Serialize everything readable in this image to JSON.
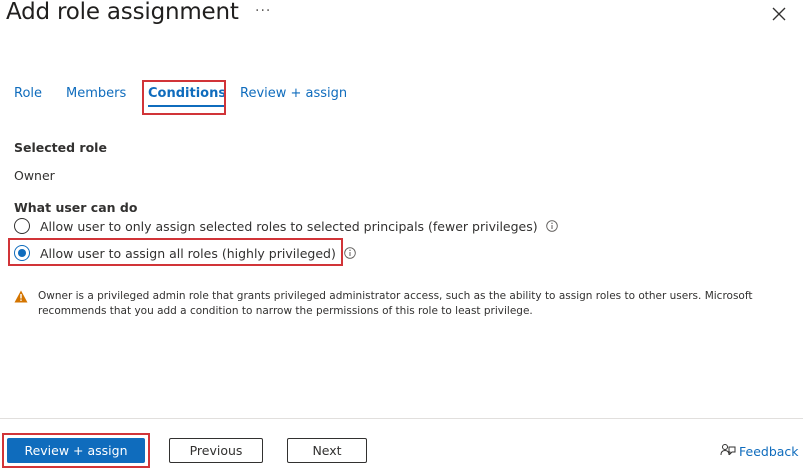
{
  "header": {
    "title": "Add role assignment",
    "more_label": "···"
  },
  "tabs": [
    {
      "label": "Role",
      "active": false
    },
    {
      "label": "Members",
      "active": false
    },
    {
      "label": "Conditions",
      "active": true
    },
    {
      "label": "Review + assign",
      "active": false
    }
  ],
  "selected_role": {
    "heading": "Selected role",
    "value": "Owner"
  },
  "what_user_can_do": {
    "heading": "What user can do",
    "options": [
      {
        "label": "Allow user to only assign selected roles to selected principals (fewer privileges)",
        "selected": false
      },
      {
        "label": "Allow user to assign all roles (highly privileged)",
        "selected": true
      }
    ]
  },
  "warning": {
    "text": "Owner is a privileged admin role that grants privileged administrator access, such as the ability to assign roles to other users. Microsoft recommends that you add a condition to narrow the permissions of this role to least privilege."
  },
  "footer": {
    "review_assign_label": "Review + assign",
    "previous_label": "Previous",
    "next_label": "Next",
    "feedback_label": "Feedback"
  },
  "colors": {
    "accent": "#0f6cbd",
    "highlight_border": "#d13438",
    "warning_icon": "#d47500"
  },
  "icons": {
    "more": "ellipsis-icon",
    "close": "close-icon",
    "info": "info-icon",
    "warning": "warning-icon",
    "feedback": "feedback-icon"
  }
}
